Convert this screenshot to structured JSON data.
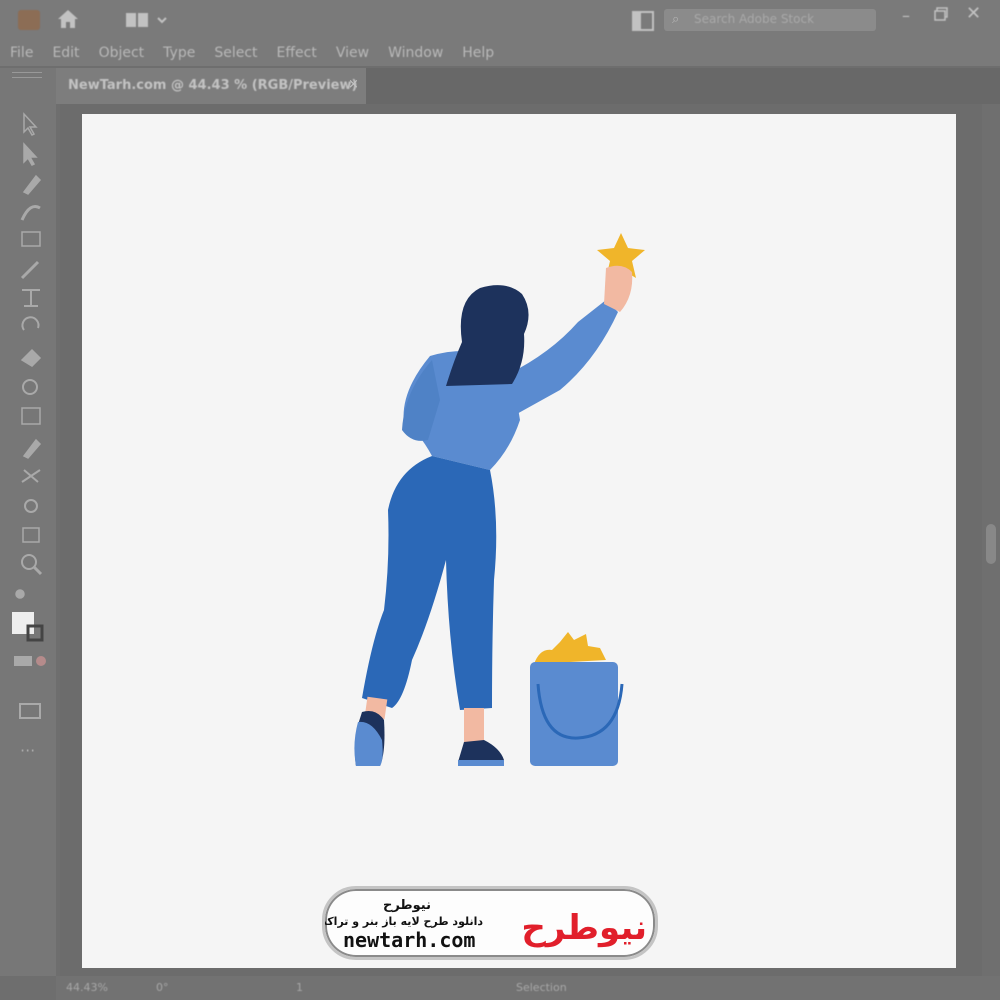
{
  "titlebar": {
    "app_icon": "illustrator-app-icon",
    "home_icon": "home-icon",
    "workspace_icon": "workspace-switcher-icon",
    "search_placeholder": "Search Adobe Stock"
  },
  "menu": [
    "File",
    "Edit",
    "Object",
    "Type",
    "Select",
    "Effect",
    "View",
    "Window",
    "Help"
  ],
  "document_tab": {
    "label": "NewTarh.com @ 44.43 % (RGB/Preview)",
    "close": "×"
  },
  "statusbar": {
    "zoom": "44.43%",
    "rotation": "0°",
    "artboard": "1",
    "tool": "Selection"
  },
  "tools": [
    "selection-tool-icon",
    "direct-selection-tool-icon",
    "pen-tool-icon",
    "curvature-tool-icon",
    "rectangle-tool-icon",
    "paintbrush-tool-icon",
    "type-tool-icon",
    "rotate-tool-icon",
    "eraser-tool-icon",
    "shape-builder-tool-icon",
    "gradient-tool-icon",
    "eyedropper-tool-icon",
    "blend-tool-icon",
    "symbol-sprayer-tool-icon",
    "artboard-tool-icon",
    "zoom-tool-icon",
    "fill-stroke-icon",
    "drawing-mode-icon",
    "screen-mode-icon",
    "more-tools-icon"
  ],
  "logo": {
    "brand_fa": "نیوطرح",
    "title_fa": "نیوطرح",
    "subtitle_fa": "دانلود طرح لایه باز بنر و تراکت",
    "domain": "newtarh.com"
  },
  "colors": {
    "shirt": "#5a8bd0",
    "pants": "#2b68b7",
    "hair": "#1d325c",
    "skin": "#f2b9a2",
    "star": "#f0b52a",
    "bucket": "#5a8bd0",
    "logo_red": "#e11f2b"
  }
}
